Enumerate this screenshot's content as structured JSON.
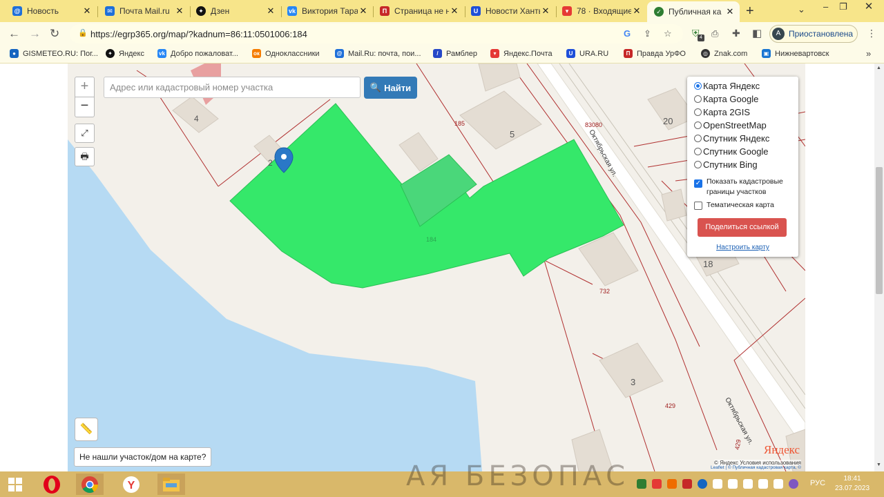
{
  "browser": {
    "tabs": [
      {
        "title": "Новость",
        "icon": "mailru-at-icon",
        "color": "#1e6fd9"
      },
      {
        "title": "Почта Mail.ru",
        "icon": "mail-envelope-icon",
        "color": "#1e6fd9"
      },
      {
        "title": "Дзен",
        "icon": "zen-star-icon",
        "color": "#111111"
      },
      {
        "title": "Виктория Тара",
        "icon": "vk-icon",
        "color": "#2787f5"
      },
      {
        "title": "Страница не н",
        "icon": "pravda-icon",
        "color": "#c62828"
      },
      {
        "title": "Новости Ханты",
        "icon": "ura-u-icon",
        "color": "#1e4fd9"
      },
      {
        "title": "78 · Входящие",
        "icon": "yandex-mail-icon",
        "color": "#e53935"
      },
      {
        "title": "Публичная ка",
        "icon": "check-circle-icon",
        "color": "#2e7d32",
        "active": true
      }
    ],
    "url": "https://egrp365.org/map/?kadnum=86:11:0501006:184",
    "profile_avatar": "A",
    "profile_label": "Приостановлена",
    "extension_badge": "4"
  },
  "bookmarks": [
    {
      "label": "GISMETEO.RU: Пог...",
      "color": "#1565c0"
    },
    {
      "label": "Яндекс",
      "color": "#111111"
    },
    {
      "label": "Добро пожаловат...",
      "color": "#2787f5"
    },
    {
      "label": "Одноклассники",
      "color": "#f57c00"
    },
    {
      "label": "Mail.Ru: почта, пои...",
      "color": "#1e6fd9"
    },
    {
      "label": "Рамблер",
      "color": "#2648c7"
    },
    {
      "label": "Яндекс.Почта",
      "color": "#e53935"
    },
    {
      "label": "URA.RU",
      "color": "#1e4fd9"
    },
    {
      "label": "Правда УрФО",
      "color": "#c62828"
    },
    {
      "label": "Znak.com",
      "color": "#333333"
    },
    {
      "label": "Нижневартовск",
      "color": "#1976d2"
    }
  ],
  "map": {
    "search_placeholder": "Адрес или кадастровый номер участка",
    "search_button": "Найти",
    "zoom_in": "+",
    "zoom_out": "−",
    "layers": [
      {
        "label": "Карта Яндекс",
        "selected": true
      },
      {
        "label": "Карта Google",
        "selected": false
      },
      {
        "label": "Карта 2GIS",
        "selected": false
      },
      {
        "label": "OpenStreetMap",
        "selected": false
      },
      {
        "label": "Спутник Яндекс",
        "selected": false
      },
      {
        "label": "Спутник Google",
        "selected": false
      },
      {
        "label": "Спутник Bing",
        "selected": false
      }
    ],
    "show_boundaries_label": "Показать кадастровые границы участков",
    "show_boundaries_checked": true,
    "thematic_label": "Тематическая карта",
    "thematic_checked": false,
    "share_button": "Поделиться ссылкой",
    "configure_link": "Настроить карту",
    "not_found": "Не нашли участок/дом на карте?",
    "attribution": "© Яндекс  Условия использования",
    "attribution2": "Leaflet | © Публичная кадастровая карта, ©",
    "yandex_logo": "Яндекс",
    "labels": {
      "building_4": "4",
      "building_2": "2",
      "building_5": "5",
      "building_20": "20",
      "building_18": "18",
      "building_3": "3",
      "parcel_185": "185",
      "parcel_184": "184",
      "parcel_732": "732",
      "parcel_429": "429",
      "parcel_83080": "83080",
      "street_1": "Октябрьская ул.",
      "street_2": "Октябрьская ул.",
      "parcel_429_2": "429"
    },
    "colors": {
      "water": "#b6daf3",
      "highlight": "#35e86a",
      "boundary": "#b03030",
      "land": "#f3f0ea"
    }
  },
  "taskbar": {
    "watermark": "АЯ БЕЗОПАС",
    "language": "РУС",
    "time": "18:41",
    "date": "23.07.2023"
  }
}
